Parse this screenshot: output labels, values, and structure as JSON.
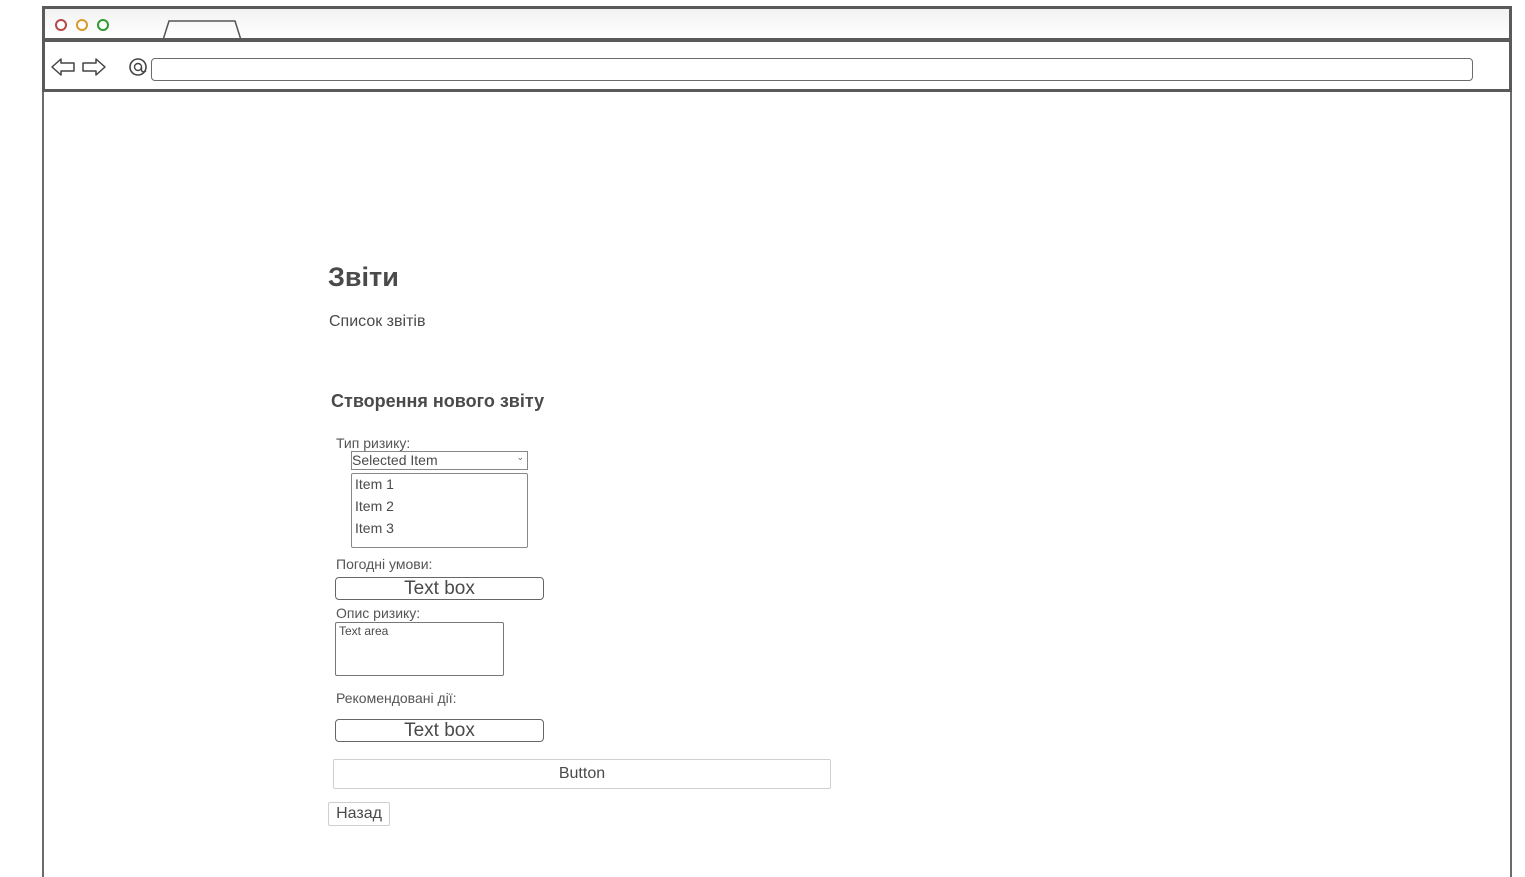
{
  "page": {
    "title": "Звіти",
    "reports_link": "Список звітів",
    "section_title": "Створення нового звіту"
  },
  "form": {
    "risk_type": {
      "label": "Тип ризику:",
      "selected": "Selected Item",
      "options": [
        "Item 1",
        "Item 2",
        "Item 3"
      ]
    },
    "weather": {
      "label": "Погодні умови:",
      "value": "Text box"
    },
    "risk_description": {
      "label": "Опис ризику:",
      "value": "Text area"
    },
    "recommended_actions": {
      "label": "Рекомендовані дії:",
      "value": "Text box"
    },
    "submit_label": "Button",
    "back_label": "Назад"
  },
  "browser": {
    "icons": [
      "back-arrow-icon",
      "forward-arrow-icon",
      "reload-icon"
    ],
    "window_controls": {
      "close_color": "#b84747",
      "minimize_color": "#d99a2b",
      "maximize_color": "#2f9a2f"
    }
  }
}
